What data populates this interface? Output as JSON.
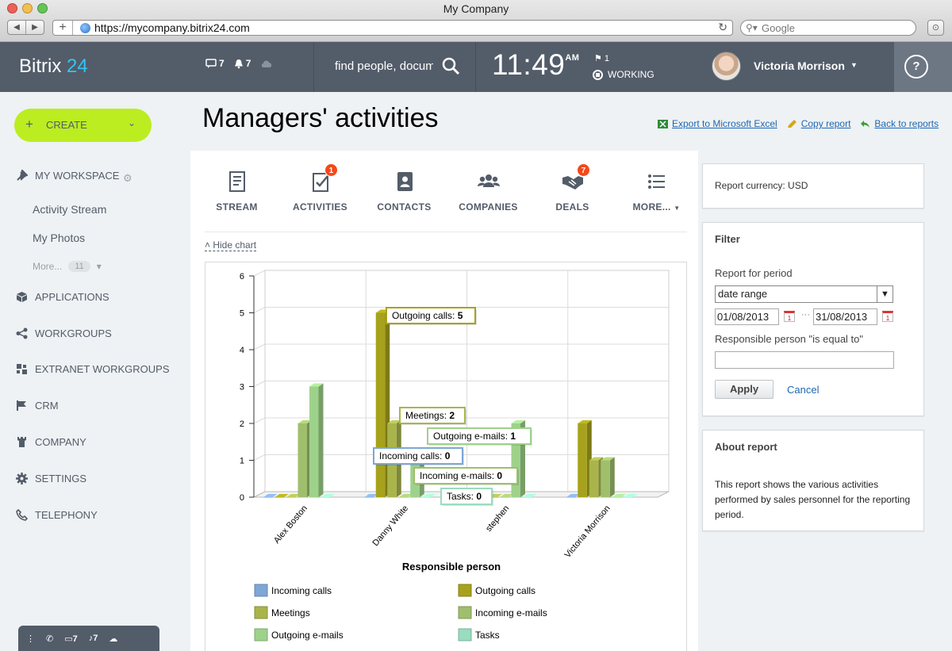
{
  "browser": {
    "window_title": "My Company",
    "url": "https://mycompany.bitrix24.com",
    "search_placeholder": "Google"
  },
  "header": {
    "logo_text": "Bitrix",
    "logo_num": "24",
    "messages_count": "7",
    "notifications_count": "7",
    "search_placeholder": "find people, documents...",
    "time": "11:49",
    "ampm": "AM",
    "flag_count": "1",
    "work_status": "WORKING",
    "user_name": "Victoria Morrison",
    "help_label": "?"
  },
  "sidebar": {
    "create_label": "CREATE",
    "my_workspace": "MY WORKSPACE",
    "sub_items": [
      "Activity Stream",
      "My Photos"
    ],
    "more_label": "More...",
    "more_count": "11",
    "items": [
      "APPLICATIONS",
      "WORKGROUPS",
      "EXTRANET WORKGROUPS",
      "CRM",
      "COMPANY",
      "SETTINGS",
      "TELEPHONY"
    ],
    "bottom_bar": {
      "messages": "7",
      "notifications": "7"
    }
  },
  "page": {
    "title": "Managers' activities",
    "links": {
      "export": "Export to Microsoft Excel",
      "copy": "Copy report",
      "back": "Back to reports"
    },
    "hide_chart": "Hide chart"
  },
  "crm_tabs": [
    {
      "label": "STREAM",
      "icon": "stream-icon",
      "badge": ""
    },
    {
      "label": "ACTIVITIES",
      "icon": "activities-icon",
      "badge": "1"
    },
    {
      "label": "CONTACTS",
      "icon": "contacts-icon",
      "badge": ""
    },
    {
      "label": "COMPANIES",
      "icon": "companies-icon",
      "badge": ""
    },
    {
      "label": "DEALS",
      "icon": "deals-icon",
      "badge": "7"
    },
    {
      "label": "MORE...",
      "icon": "more-icon",
      "badge": ""
    }
  ],
  "right": {
    "currency": "Report currency: USD",
    "filter_title": "Filter",
    "period_label": "Report for period",
    "period_value": "date range",
    "date_from": "01/08/2013",
    "date_to": "31/08/2013",
    "person_label": "Responsible person \"is equal to\"",
    "person_value": "",
    "apply": "Apply",
    "cancel": "Cancel",
    "about_title": "About report",
    "about_text": "This report shows the various activities performed by sales personnel for the reporting period."
  },
  "chart_data": {
    "type": "bar",
    "xlabel": "Responsible person",
    "ylabel": "",
    "ylim": [
      0,
      6
    ],
    "yticks": [
      "0",
      "1",
      "2",
      "3",
      "4",
      "5",
      "6"
    ],
    "categories": [
      "Alex Boston",
      "Danny White",
      "stephen",
      "Victoria Morrison"
    ],
    "series": [
      {
        "name": "Incoming calls",
        "color": "#7ea6d6",
        "values": [
          0,
          0,
          0,
          0
        ]
      },
      {
        "name": "Outgoing calls",
        "color": "#a7a21c",
        "values": [
          0,
          5,
          0,
          2
        ]
      },
      {
        "name": "Meetings",
        "color": "#a9b54a",
        "values": [
          0,
          2,
          0,
          1
        ]
      },
      {
        "name": "Incoming e-mails",
        "color": "#9fbf6d",
        "values": [
          2,
          0,
          0,
          1
        ]
      },
      {
        "name": "Outgoing e-mails",
        "color": "#9ed28a",
        "values": [
          3,
          1,
          2,
          0
        ]
      },
      {
        "name": "Tasks",
        "color": "#9adcc0",
        "values": [
          0,
          0,
          0,
          0
        ]
      }
    ],
    "tooltips": [
      {
        "label": "Outgoing calls:",
        "value": "5"
      },
      {
        "label": "Meetings:",
        "value": "2"
      },
      {
        "label": "Outgoing e-mails:",
        "value": "1"
      },
      {
        "label": "Incoming calls:",
        "value": "0"
      },
      {
        "label": "Incoming e-mails:",
        "value": "0"
      },
      {
        "label": "Tasks:",
        "value": "0"
      }
    ],
    "legend_placement": "bottom"
  }
}
